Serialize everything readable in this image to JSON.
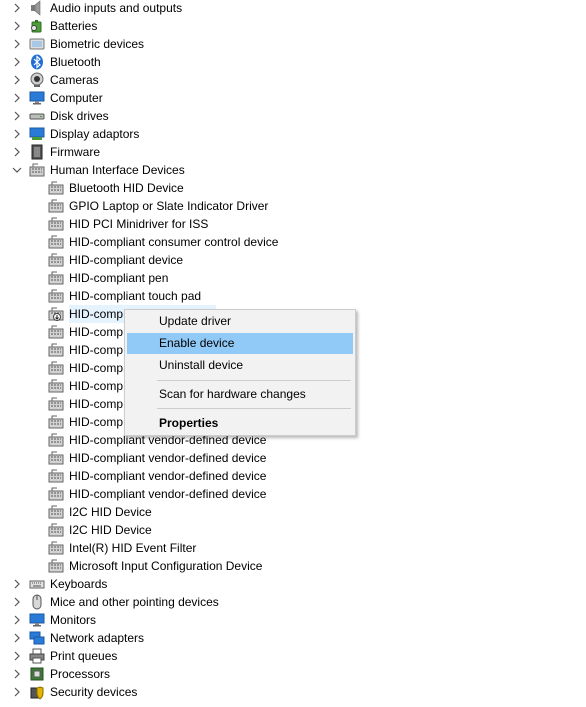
{
  "categories_top": [
    {
      "label": "Audio inputs and outputs",
      "icon": "speaker-icon"
    },
    {
      "label": "Batteries",
      "icon": "battery-icon"
    },
    {
      "label": "Biometric devices",
      "icon": "biometric-icon"
    },
    {
      "label": "Bluetooth",
      "icon": "bluetooth-icon"
    },
    {
      "label": "Cameras",
      "icon": "camera-icon"
    },
    {
      "label": "Computer",
      "icon": "monitor-icon"
    },
    {
      "label": "Disk drives",
      "icon": "disk-drive-icon"
    },
    {
      "label": "Display adaptors",
      "icon": "display-adapter-icon"
    },
    {
      "label": "Firmware",
      "icon": "chip-icon"
    }
  ],
  "expanded_category": {
    "label": "Human Interface Devices",
    "icon": "hid-icon"
  },
  "hid_devices": [
    {
      "label": "Bluetooth HID Device"
    },
    {
      "label": "GPIO Laptop or Slate Indicator Driver"
    },
    {
      "label": "HID PCI Minidriver for ISS"
    },
    {
      "label": "HID-compliant consumer control device"
    },
    {
      "label": "HID-compliant device"
    },
    {
      "label": "HID-compliant pen"
    },
    {
      "label": "HID-compliant touch pad"
    },
    {
      "label": "HID-comp",
      "selected": true,
      "disabled": true
    },
    {
      "label": "HID-comp"
    },
    {
      "label": "HID-comp"
    },
    {
      "label": "HID-comp"
    },
    {
      "label": "HID-comp"
    },
    {
      "label": "HID-comp"
    },
    {
      "label": "HID-comp"
    },
    {
      "label": "HID-compliant vendor-defined device"
    },
    {
      "label": "HID-compliant vendor-defined device"
    },
    {
      "label": "HID-compliant vendor-defined device"
    },
    {
      "label": "HID-compliant vendor-defined device"
    },
    {
      "label": "I2C HID Device"
    },
    {
      "label": "I2C HID Device"
    },
    {
      "label": "Intel(R) HID Event Filter"
    },
    {
      "label": "Microsoft Input Configuration Device"
    }
  ],
  "categories_bottom": [
    {
      "label": "Keyboards",
      "icon": "keyboard-icon"
    },
    {
      "label": "Mice and other pointing devices",
      "icon": "mouse-icon"
    },
    {
      "label": "Monitors",
      "icon": "monitor-icon"
    },
    {
      "label": "Network adapters",
      "icon": "network-icon"
    },
    {
      "label": "Print queues",
      "icon": "printer-icon"
    },
    {
      "label": "Processors",
      "icon": "processor-icon"
    },
    {
      "label": "Security devices",
      "icon": "security-icon"
    }
  ],
  "context_menu": {
    "update_driver": "Update driver",
    "enable_device": "Enable device",
    "uninstall_device": "Uninstall device",
    "scan_changes": "Scan for hardware changes",
    "properties": "Properties"
  },
  "colors": {
    "menu_highlight": "#91c9f7",
    "menu_background": "#f2f2f2",
    "selection": "#e5f3ff",
    "folder_blue": "#2a7ad8"
  }
}
